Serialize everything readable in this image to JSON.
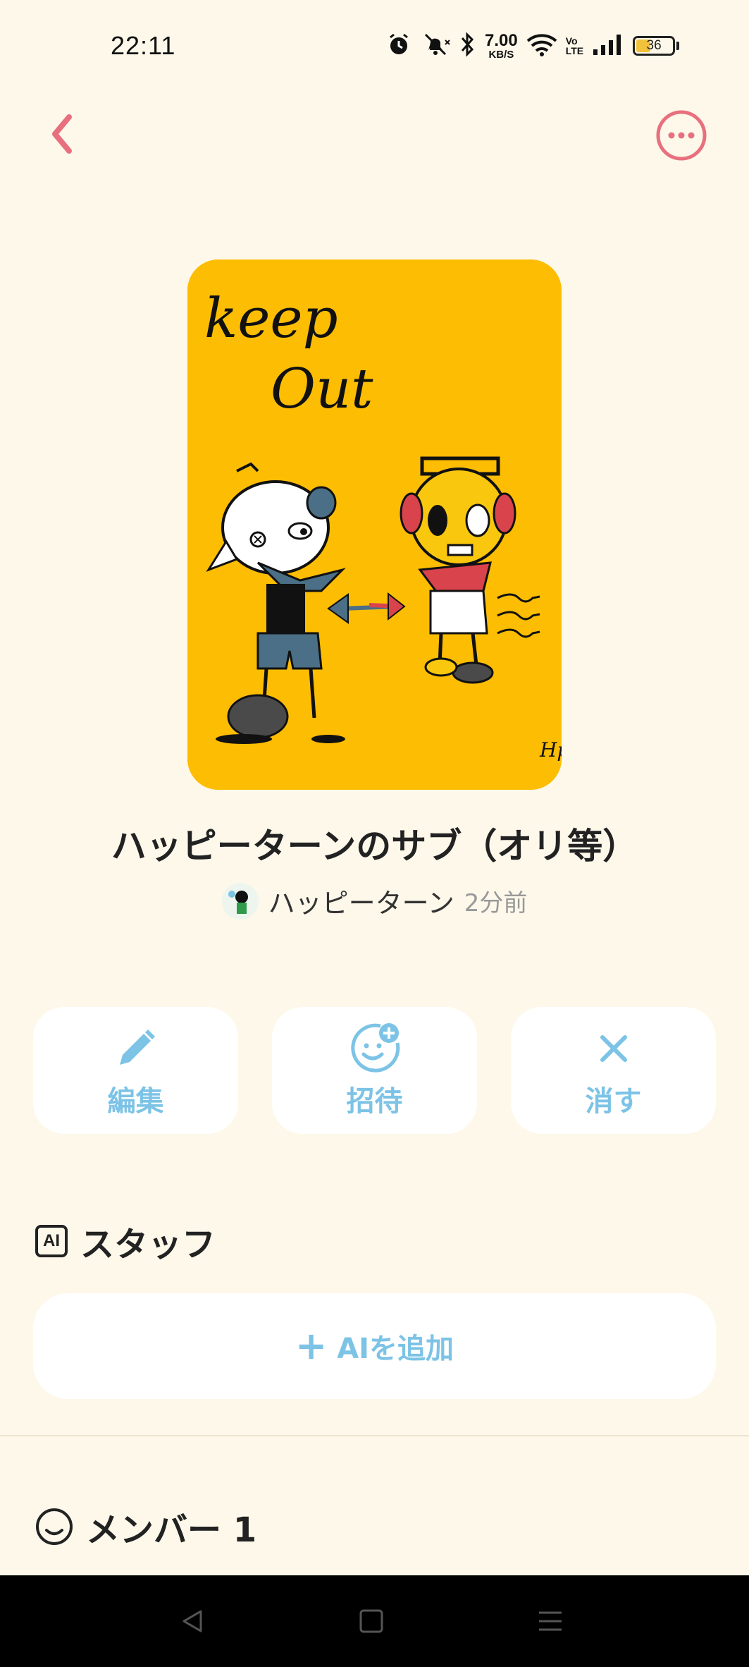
{
  "status_bar": {
    "time": "22:11",
    "net_speed_value": "7.00",
    "net_speed_unit": "KB/S",
    "volte_top": "Vo",
    "volte_bottom": "LTE",
    "battery_level": "36",
    "battery_fraction": 0.36
  },
  "cover_art": {
    "text_line1": "keep",
    "text_line2": "Out",
    "signature": "Hp",
    "background_color": "#fdbd02"
  },
  "group": {
    "title": "ハッピーターンのサブ（オリ等）",
    "owner_name": "ハッピーターン",
    "updated": "2分前"
  },
  "actions": {
    "edit_label": "編集",
    "invite_label": "招待",
    "delete_label": "消す"
  },
  "staff_section": {
    "badge": "AI",
    "title": "スタッフ",
    "add_ai_label": "AIを追加"
  },
  "members_section": {
    "title": "メンバー 1"
  },
  "colors": {
    "background": "#fdf8ea",
    "accent_pink": "#e8707e",
    "accent_blue": "#7cc3e6",
    "card": "#ffffff"
  }
}
